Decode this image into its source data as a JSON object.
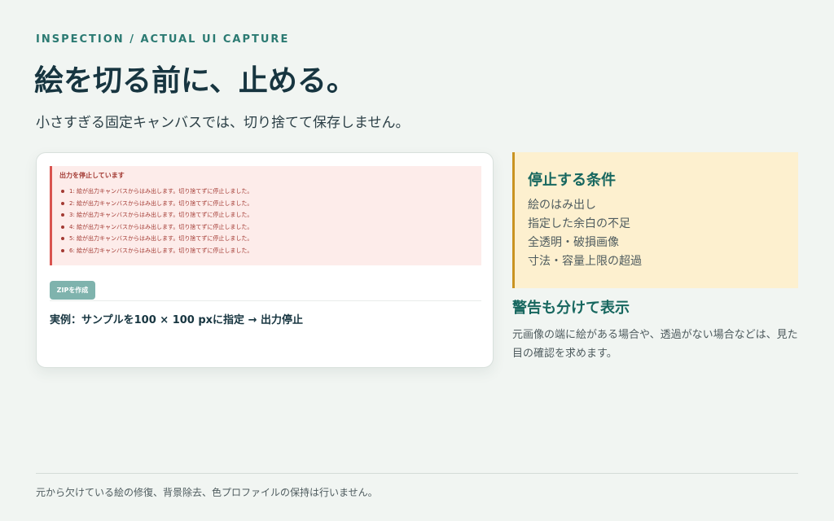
{
  "header": {
    "eyebrow": "INSPECTION / ACTUAL UI CAPTURE",
    "title": "絵を切る前に、止める。",
    "subtitle": "小さすぎる固定キャンバスでは、切り捨てて保存しません。"
  },
  "preview": {
    "error_title": "出力を停止しています",
    "errors": [
      "1: 絵が出力キャンバスからはみ出します。切り捨てずに停止しました。",
      "2: 絵が出力キャンバスからはみ出します。切り捨てずに停止しました。",
      "3: 絵が出力キャンバスからはみ出します。切り捨てずに停止しました。",
      "4: 絵が出力キャンバスからはみ出します。切り捨てずに停止しました。",
      "5: 絵が出力キャンバスからはみ出します。切り捨てずに停止しました。",
      "6: 絵が出力キャンバスからはみ出します。切り捨てずに停止しました。"
    ],
    "zip_button_label": "ZIPを作成",
    "example_caption": "実例：サンプルを100 × 100 pxに指定 → 出力停止"
  },
  "conditions": {
    "title": "停止する条件",
    "items": [
      "絵のはみ出し",
      "指定した余白の不足",
      "全透明・破損画像",
      "寸法・容量上限の超過"
    ]
  },
  "warnings": {
    "heading": "警告も分けて表示",
    "body": "元画像の端に絵がある場合や、透過がない場合などは、見た目の確認を求めます。"
  },
  "footer": {
    "note": "元から欠けている絵の修復、背景除去、色プロファイルの保持は行いません。"
  },
  "colors": {
    "accent": "#17675f",
    "error": "#a33a33",
    "warning_border": "#c99322",
    "button": "#7fb3ad"
  }
}
